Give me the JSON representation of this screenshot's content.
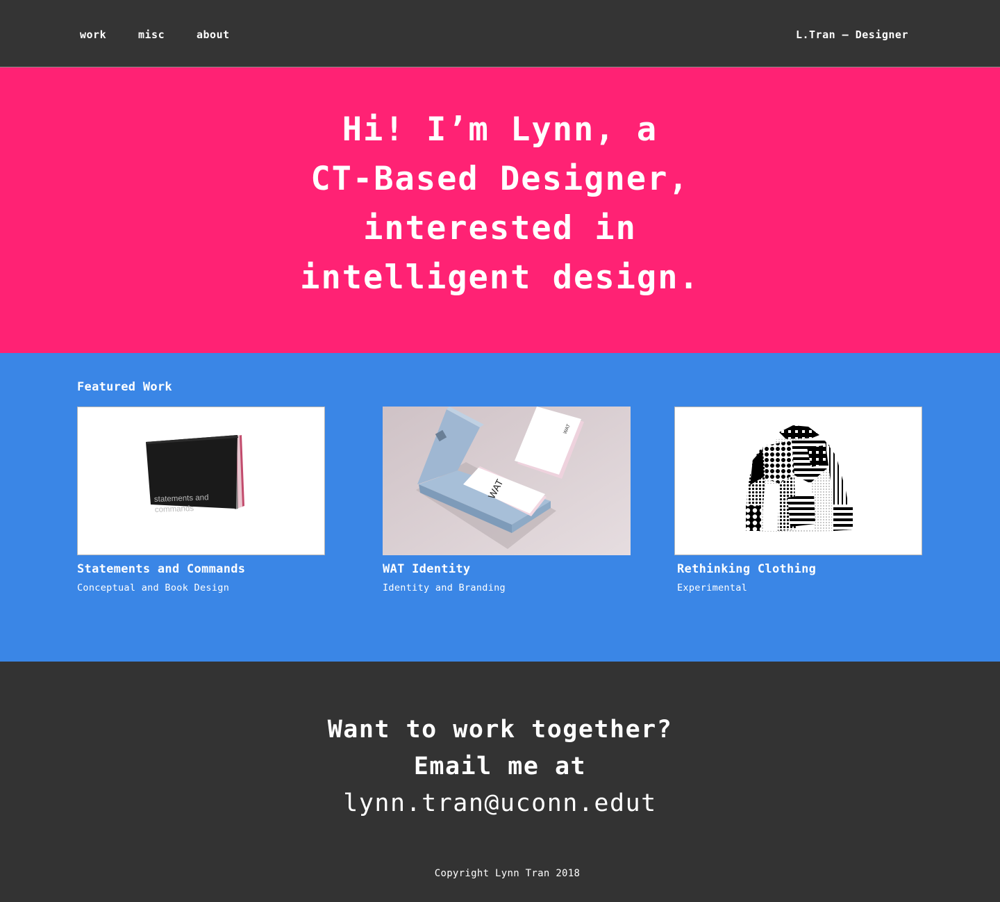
{
  "nav": {
    "items": [
      {
        "label": "work"
      },
      {
        "label": "misc"
      },
      {
        "label": "about"
      }
    ],
    "brand": "L.Tran — Designer"
  },
  "hero": {
    "lines": [
      "Hi! I’m Lynn, a",
      "CT-Based Designer,",
      "interested in",
      "intelligent design."
    ]
  },
  "featured": {
    "title": "Featured Work",
    "cards": [
      {
        "title": "Statements and Commands",
        "subtitle": "Conceptual and Book Design",
        "image_text": "statements and\ncommands"
      },
      {
        "title": "WAT Identity",
        "subtitle": "Identity and Branding",
        "image_text": "WAT"
      },
      {
        "title": "Rethinking Clothing",
        "subtitle": "Experimental"
      }
    ]
  },
  "contact": {
    "line1": "Want to work together?",
    "line2": "Email me at",
    "email": "lynn.tran@uconn.edut"
  },
  "footer": {
    "copyright": "Copyright Lynn Tran 2018"
  },
  "colors": {
    "topbar": "#343434",
    "hero_bg": "#ff2274",
    "featured_bg": "#3a86e6",
    "footer_bg": "#333333",
    "text": "#ffffff"
  }
}
